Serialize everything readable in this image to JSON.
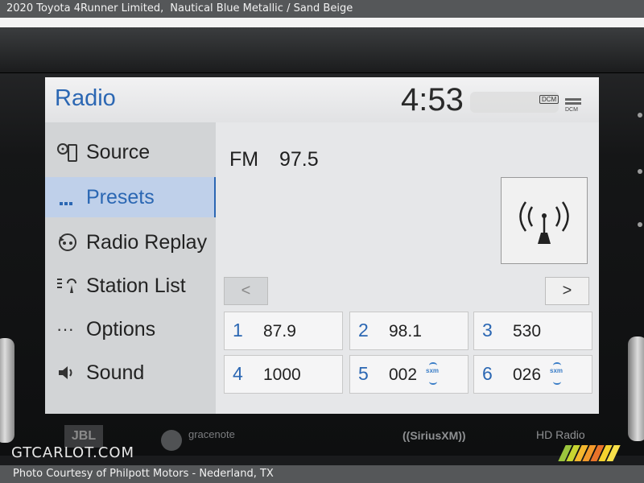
{
  "caption": {
    "title": "2020 Toyota 4Runner Limited,",
    "subtitle": "Nautical Blue Metallic / Sand Beige"
  },
  "header": {
    "title": "Radio",
    "clock": "4:53",
    "dcm_badge": "DCM",
    "dcm_label": "DCM"
  },
  "sidebar": {
    "items": [
      {
        "label": "Source",
        "icon": "source-icon"
      },
      {
        "label": "Presets",
        "icon": "presets-icon",
        "active": true
      },
      {
        "label": "Radio Replay",
        "icon": "radio-replay-icon"
      },
      {
        "label": "Station List",
        "icon": "station-list-icon"
      },
      {
        "label": "Options",
        "icon": "options-icon"
      },
      {
        "label": "Sound",
        "icon": "sound-icon"
      }
    ]
  },
  "tuner": {
    "band": "FM",
    "frequency": "97.5",
    "antenna_icon": "antenna-signal-icon"
  },
  "nav": {
    "prev": "<",
    "next": ">"
  },
  "presets": [
    {
      "num": "1",
      "freq": "87.9",
      "sxm": false
    },
    {
      "num": "2",
      "freq": "98.1",
      "sxm": false
    },
    {
      "num": "3",
      "freq": "530",
      "sxm": false
    },
    {
      "num": "4",
      "freq": "1000",
      "sxm": false
    },
    {
      "num": "5",
      "freq": "002",
      "sxm": true
    },
    {
      "num": "6",
      "freq": "026",
      "sxm": true
    }
  ],
  "sxm_badge": "sxm",
  "bezel_logos": {
    "jbl": "JBL",
    "gracenote": "gracenote",
    "siriusxm": "((SiriusXM))",
    "hdradio": "HD Radio"
  },
  "watermark": "GTCARLOT.COM",
  "footer": "Photo Courtesy of Philpott Motors - Nederland, TX",
  "colors": {
    "accent": "#2b67b3",
    "screen_bg": "#e6e7e9",
    "sidebar_bg": "#d2d4d6",
    "active_bg": "#bfd0ea"
  }
}
